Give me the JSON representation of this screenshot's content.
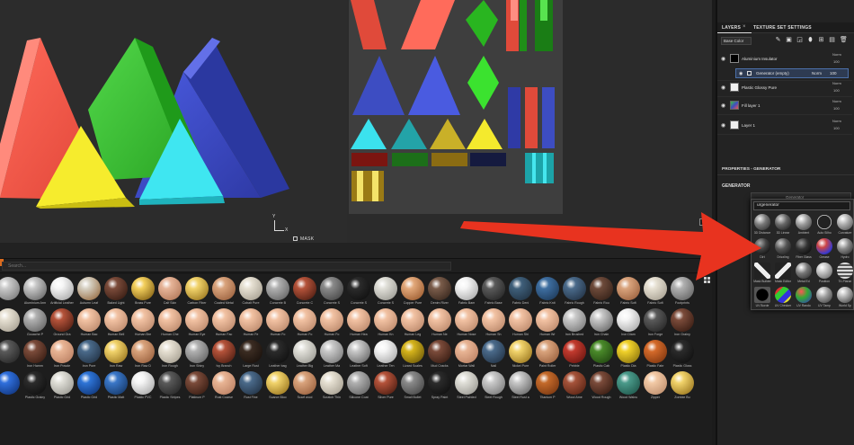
{
  "right_panel": {
    "tabs": {
      "layers": "LAYERS",
      "texture_set": "TEXTURE SET SETTINGS",
      "close": "×"
    },
    "channel_select": "Base Color",
    "layers": [
      {
        "name": "Aluminium Insulator",
        "blend": "Norm",
        "opacity": "100"
      },
      {
        "name": "Plastic Glossy Pure",
        "blend": "Norm",
        "opacity": "100"
      },
      {
        "name": "Fill layer 1",
        "blend": "Norm",
        "opacity": "100"
      },
      {
        "name": "Layer 1",
        "blend": "Norm",
        "opacity": "100"
      }
    ],
    "sublayer": {
      "name": "Generator (empty)",
      "blend": "Norm",
      "opacity": "100"
    },
    "properties_title": "PROPERTIES - GENERATOR",
    "generator_label": "GENERATOR",
    "generator_field": "Generator"
  },
  "viewport": {
    "mask_label": "MASK",
    "axis_y": "Y",
    "axis_x": "X",
    "uv_axis": "U"
  },
  "shelf": {
    "search_placeholder": "Search...",
    "rows": [
      [
        "",
        "Aluminium Arm",
        "Artificial Leather",
        "Autumn Leaf",
        "Baked Light",
        "Brass Pure",
        "Calf Skin",
        "Carbon Fiber",
        "Coated Metal",
        "Cobalt Pure",
        "Concrete B",
        "Concrete C",
        "Concrete S",
        "Concrete S",
        "Concrete S",
        "Copper Pure",
        "Denim River",
        "Fabric Bam",
        "Fabric Base",
        "Fabric Deni",
        "Fabric Knit",
        "Fabric Rough",
        "Fabric Rou",
        "Fabric Soft",
        "Fabric Soft",
        "Footprints"
      ],
      [
        "",
        "Gouache P",
        "Ground Gra",
        "Human Bac",
        "Human Bell",
        "Human Bre",
        "Human Che",
        "Human Eye",
        "Human Fac",
        "Human Fe",
        "Human Fo",
        "Human Fo",
        "Human Fo",
        "Human Hea",
        "Human Kn",
        "Human Leg",
        "Human Ne",
        "Human Nose",
        "Human Sh",
        "Human Shi",
        "Human Wr",
        "Iron Brushed",
        "Iron Chain",
        "Iron Diam",
        "Iron Forge",
        "Iron Grainy"
      ],
      [
        "",
        "Iron Hamm",
        "Iron Powde",
        "Iron Pure",
        "Iron Raw",
        "Iron Raw D",
        "Iron Rough",
        "Iron Shiny",
        "Ivy Branch",
        "Large Rust",
        "Leather bag",
        "Leather Big",
        "Leather Ma",
        "Leather Soft",
        "Leather Ten",
        "Lizard Scales",
        "Mud Cracks",
        "Mortar Wall",
        "Nail",
        "Nickel Pure",
        "Paint Roller",
        "Pebble",
        "Plastic Cab",
        "Plastic Dia",
        "Plastic Fabr",
        "Plastic Gloss"
      ],
      [
        "",
        "Plastic Grainy",
        "Plastic Grid",
        "Plastic Grid",
        "Plastic Matt",
        "Plastic PVC",
        "Plastic Stripes",
        "Platinum P",
        "Rust Coarse",
        "Rust Fine",
        "Scarce Bloo",
        "Scarf wool",
        "Scratch Thin",
        "Silicone Coat",
        "Silver Pure",
        "Small Bullet",
        "Spray Paint",
        "Steel Painted",
        "Steel Rough",
        "Steel Rust a",
        "Titanium P",
        "Wood Ame",
        "Wood Rough",
        "Wood Walnu",
        "Zipper",
        "Zombie Bu"
      ]
    ]
  },
  "generator_popup": {
    "search_value": "urgenerator",
    "items": [
      "3D Distance",
      "3D Linear",
      "Ambient",
      "Auto Silho",
      "Curvature",
      "Dirt",
      "Drizzling",
      "Fiber Glass",
      "Grease",
      "Hydro",
      "Mask Builder",
      "Mask Editor",
      "Metal Ed",
      "Position",
      "Tri-Planar",
      "UV Borde",
      "UV Checker",
      "UV Rando",
      "UV Tamp",
      "World Sp"
    ]
  },
  "colors": {
    "accent_red": "#e8331f",
    "selection_blue": "#4b6fa8",
    "tri_red": "#f2584a",
    "tri_green": "#3fc33a",
    "tri_blue": "#3d4dc2",
    "tri_yellow": "#f4ea2d",
    "tri_cyan": "#3be2ee"
  }
}
